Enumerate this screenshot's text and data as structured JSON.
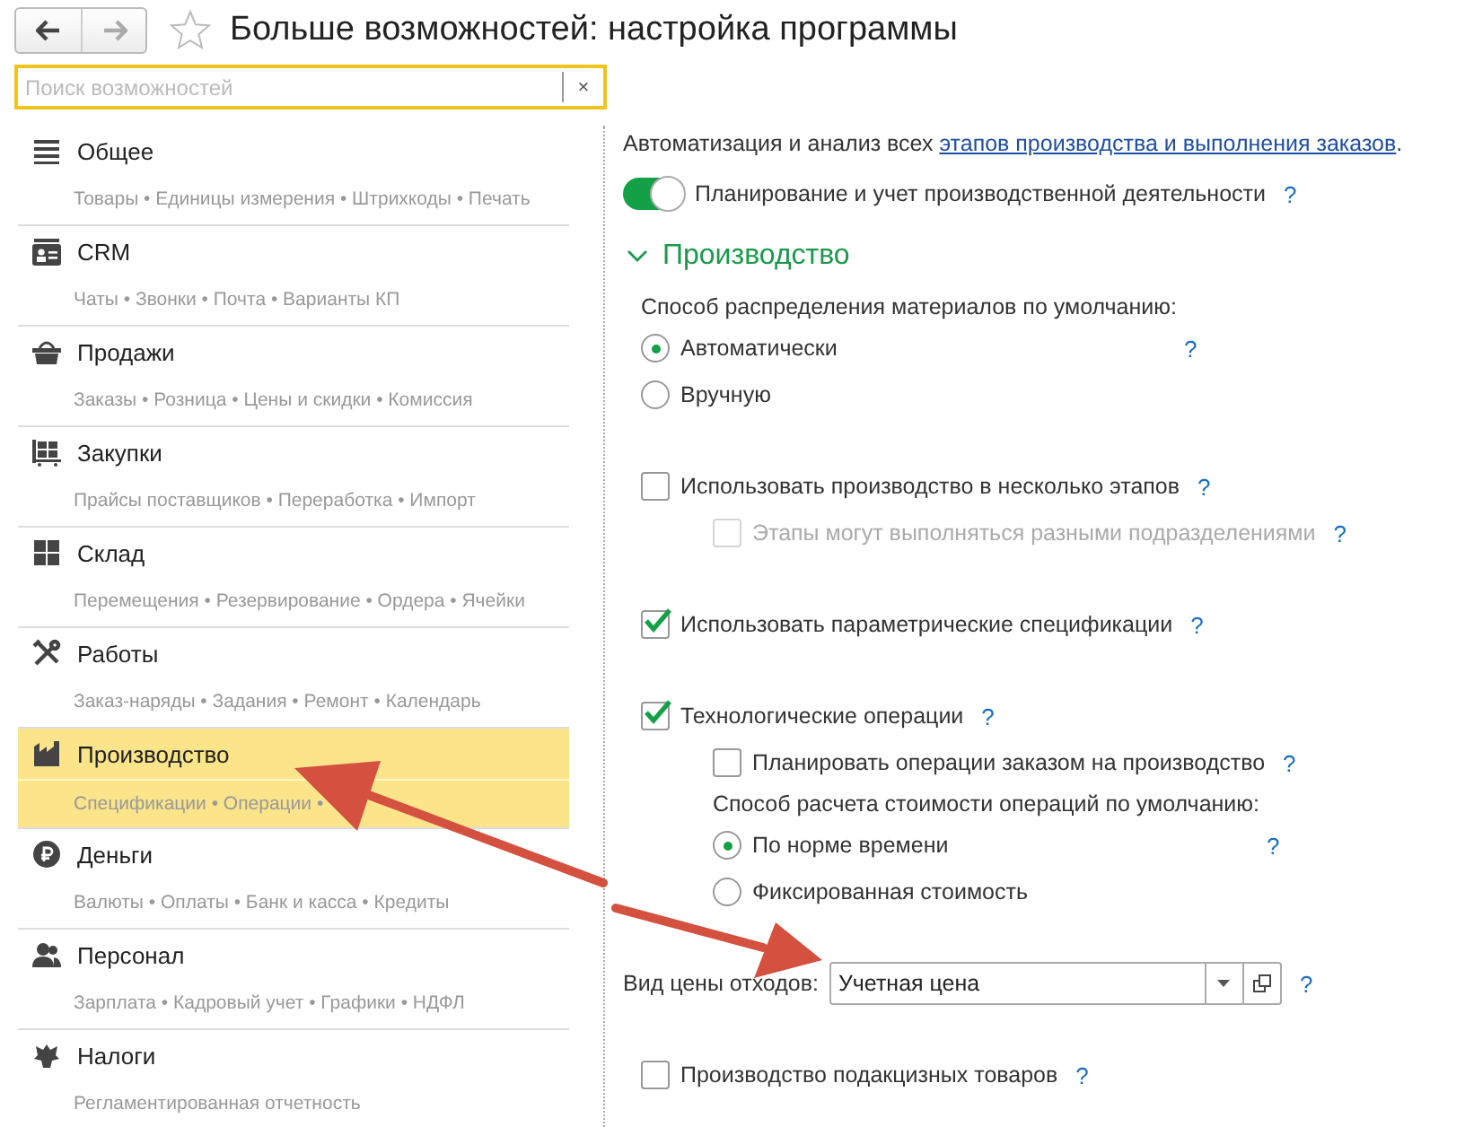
{
  "window": {
    "title": "Больше возможностей: настройка программы",
    "favorite": false
  },
  "search": {
    "placeholder": "Поиск возможностей",
    "clear": "×"
  },
  "sidebar": {
    "items": [
      {
        "title": "Общее",
        "subtitle": "Товары • Единицы измерения • Штрихкоды • Печать",
        "selected": false
      },
      {
        "title": "CRM",
        "subtitle": "Чаты • Звонки • Почта • Варианты КП",
        "selected": false
      },
      {
        "title": "Продажи",
        "subtitle": "Заказы • Розница • Цены и скидки • Комиссия",
        "selected": false
      },
      {
        "title": "Закупки",
        "subtitle": "Прайсы поставщиков • Переработка • Импорт",
        "selected": false
      },
      {
        "title": "Склад",
        "subtitle": "Перемещения • Резервирование • Ордера • Ячейки",
        "selected": false
      },
      {
        "title": "Работы",
        "subtitle": "Заказ-наряды • Задания • Ремонт • Календарь",
        "selected": false
      },
      {
        "title": "Производство",
        "subtitle": "Спецификации • Операции •",
        "selected": true
      },
      {
        "title": "Деньги",
        "subtitle": "Валюты • Оплаты • Банк и касса • Кредиты",
        "selected": false
      },
      {
        "title": "Персонал",
        "subtitle": "Зарплата • Кадровый учет • Графики • НДФЛ",
        "selected": false
      },
      {
        "title": "Налоги",
        "subtitle": "Регламентированная отчетность",
        "selected": false
      }
    ]
  },
  "content": {
    "intro": {
      "text_before": "Автоматизация и анализ всех ",
      "link": "этапов производства и выполнения заказов",
      "text_after": "."
    },
    "toggle": {
      "label": "Планирование и учет производственной деятельности",
      "on": true,
      "help": "?"
    },
    "section": {
      "title": "Производство",
      "expanded": true,
      "options": [
        {
          "kind": "radio_group",
          "caption": "Способ распределения материалов по умолчанию:",
          "help": "?",
          "options": [
            {
              "label": "Автоматически",
              "selected": true
            },
            {
              "label": "Вручную",
              "selected": false
            }
          ]
        },
        {
          "kind": "checkbox",
          "label": "Использовать производство в несколько этапов",
          "checked": false,
          "disabled": false,
          "help": "?",
          "children": [
            {
              "kind": "checkbox",
              "label": "Этапы могут выполняться разными подразделениями",
              "checked": false,
              "disabled": true,
              "help": "?"
            }
          ]
        },
        {
          "kind": "checkbox",
          "label": "Использовать параметрические спецификации",
          "checked": true,
          "disabled": false,
          "help": "?"
        },
        {
          "kind": "checkbox",
          "label": "Технологические операции",
          "checked": true,
          "disabled": false,
          "help": "?",
          "children": [
            {
              "kind": "checkbox",
              "label": "Планировать операции заказом на производство",
              "checked": false,
              "disabled": false,
              "help": "?"
            },
            {
              "kind": "radio_group",
              "caption": "Способ расчета стоимости операций по умолчанию:",
              "help": "?",
              "options": [
                {
                  "label": "По норме времени",
                  "selected": true
                },
                {
                  "label": "Фиксированная стоимость",
                  "selected": false
                }
              ]
            }
          ]
        },
        {
          "kind": "select",
          "label": "Вид цены отходов:",
          "value": "Учетная цена",
          "help": "?"
        },
        {
          "kind": "checkbox",
          "label": "Производство подакцизных товаров",
          "checked": false,
          "disabled": false,
          "help": "?"
        }
      ]
    }
  }
}
